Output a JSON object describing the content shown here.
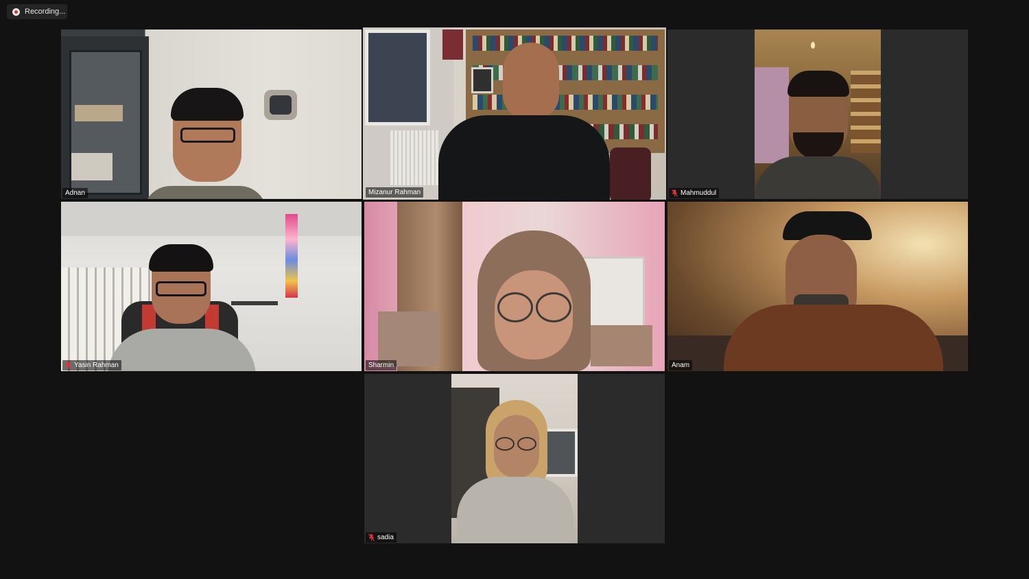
{
  "recording": {
    "label": "Recording..."
  },
  "participants": [
    {
      "name": "Adnan",
      "muted": false,
      "active": false
    },
    {
      "name": "Mizanur Rahman",
      "muted": false,
      "active": true
    },
    {
      "name": "Mahmuddul",
      "muted": true,
      "active": false
    },
    {
      "name": "Yasin Rahman",
      "muted": true,
      "active": false
    },
    {
      "name": "Sharmin",
      "muted": false,
      "active": false
    },
    {
      "name": "Anam",
      "muted": false,
      "active": false
    },
    {
      "name": "sadia",
      "muted": true,
      "active": false
    }
  ],
  "colors": {
    "background": "#121212",
    "tile": "#2b2b2b",
    "active_border": "#e9ec8f",
    "muted_icon": "#e0323b"
  }
}
